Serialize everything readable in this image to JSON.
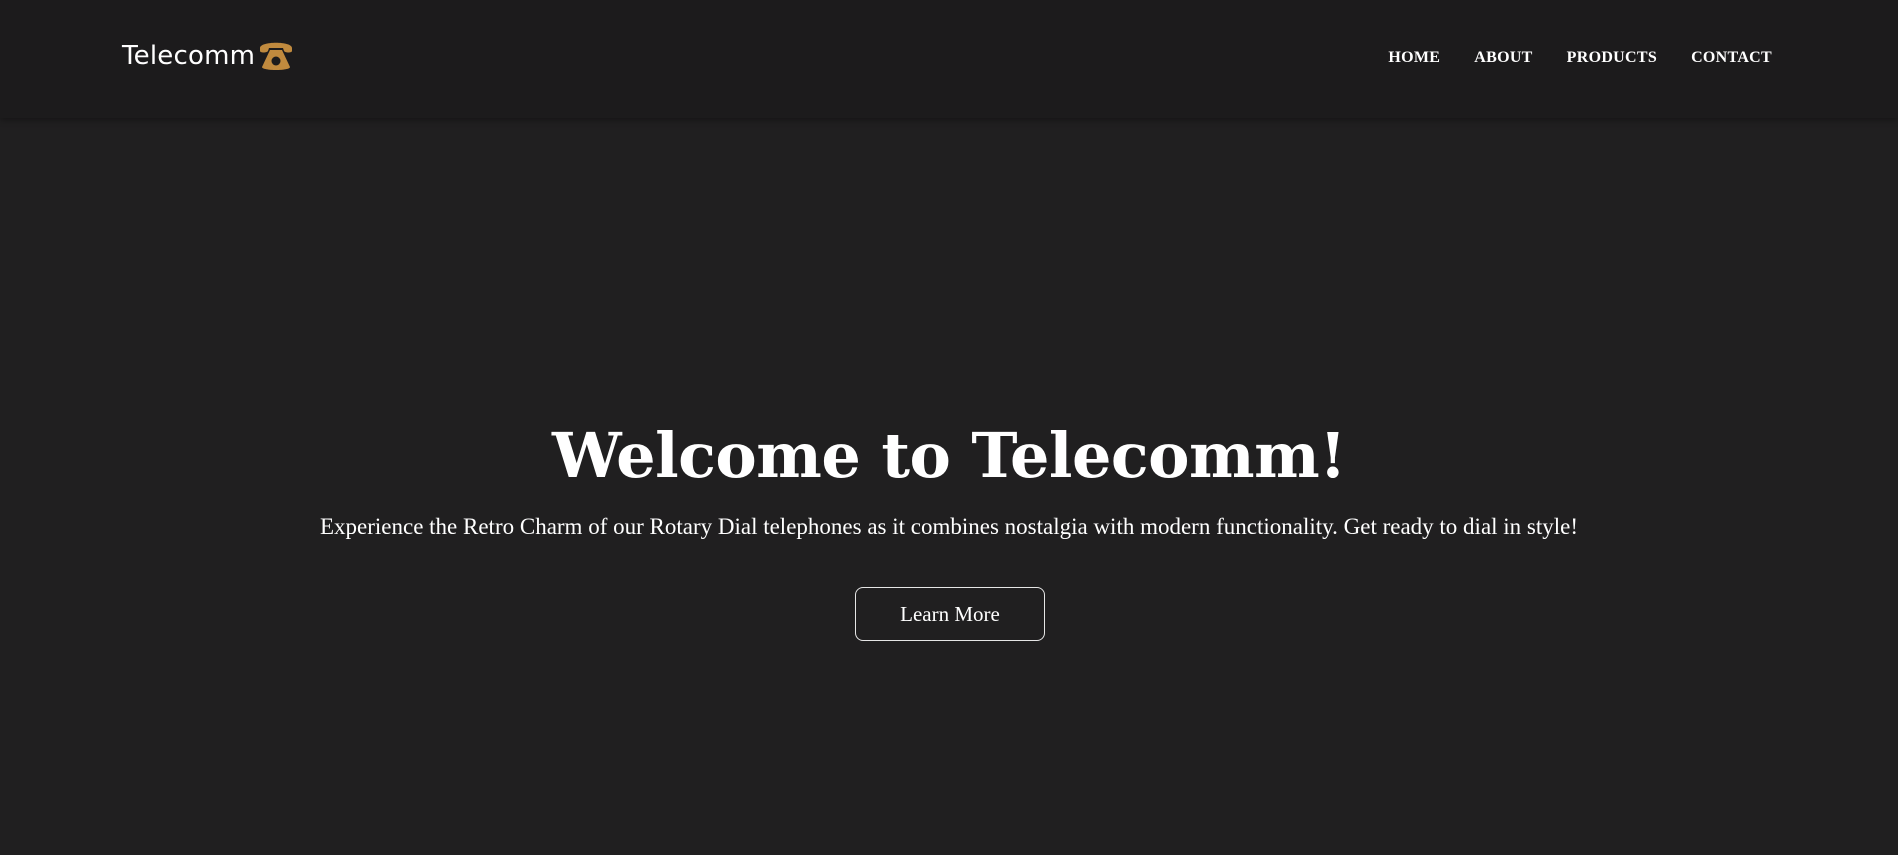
{
  "header": {
    "logo_text": "Telecomm",
    "logo_icon": "rotary-telephone-icon",
    "logo_icon_color": "#c08a3e",
    "nav": [
      {
        "label": "HOME"
      },
      {
        "label": "ABOUT"
      },
      {
        "label": "PRODUCTS"
      },
      {
        "label": "CONTACT"
      }
    ]
  },
  "hero": {
    "title": "Welcome to Telecomm!",
    "subtitle": "Experience the Retro Charm of our Rotary Dial telephones as it combines nostalgia with modern functionality. Get ready to dial in style!",
    "button_label": "Learn More"
  },
  "colors": {
    "background": "#201f20",
    "header_background": "#1c1b1c",
    "text": "#ffffff",
    "accent": "#c08a3e"
  }
}
